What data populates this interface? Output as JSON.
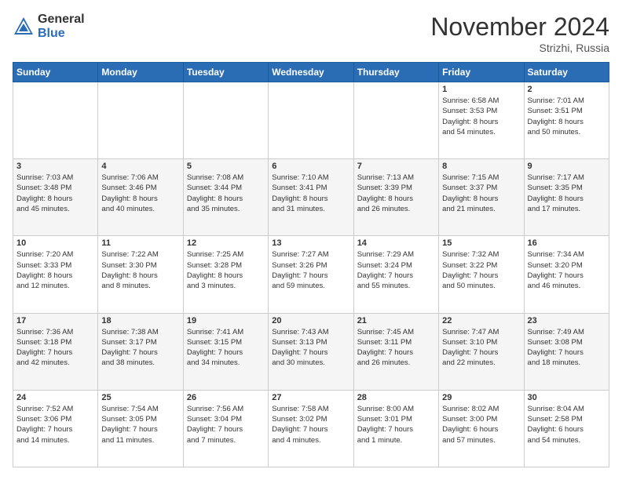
{
  "header": {
    "logo_general": "General",
    "logo_blue": "Blue",
    "title": "November 2024",
    "location": "Strizhi, Russia"
  },
  "weekdays": [
    "Sunday",
    "Monday",
    "Tuesday",
    "Wednesday",
    "Thursday",
    "Friday",
    "Saturday"
  ],
  "weeks": [
    [
      {
        "day": "",
        "info": ""
      },
      {
        "day": "",
        "info": ""
      },
      {
        "day": "",
        "info": ""
      },
      {
        "day": "",
        "info": ""
      },
      {
        "day": "",
        "info": ""
      },
      {
        "day": "1",
        "info": "Sunrise: 6:58 AM\nSunset: 3:53 PM\nDaylight: 8 hours\nand 54 minutes."
      },
      {
        "day": "2",
        "info": "Sunrise: 7:01 AM\nSunset: 3:51 PM\nDaylight: 8 hours\nand 50 minutes."
      }
    ],
    [
      {
        "day": "3",
        "info": "Sunrise: 7:03 AM\nSunset: 3:48 PM\nDaylight: 8 hours\nand 45 minutes."
      },
      {
        "day": "4",
        "info": "Sunrise: 7:06 AM\nSunset: 3:46 PM\nDaylight: 8 hours\nand 40 minutes."
      },
      {
        "day": "5",
        "info": "Sunrise: 7:08 AM\nSunset: 3:44 PM\nDaylight: 8 hours\nand 35 minutes."
      },
      {
        "day": "6",
        "info": "Sunrise: 7:10 AM\nSunset: 3:41 PM\nDaylight: 8 hours\nand 31 minutes."
      },
      {
        "day": "7",
        "info": "Sunrise: 7:13 AM\nSunset: 3:39 PM\nDaylight: 8 hours\nand 26 minutes."
      },
      {
        "day": "8",
        "info": "Sunrise: 7:15 AM\nSunset: 3:37 PM\nDaylight: 8 hours\nand 21 minutes."
      },
      {
        "day": "9",
        "info": "Sunrise: 7:17 AM\nSunset: 3:35 PM\nDaylight: 8 hours\nand 17 minutes."
      }
    ],
    [
      {
        "day": "10",
        "info": "Sunrise: 7:20 AM\nSunset: 3:33 PM\nDaylight: 8 hours\nand 12 minutes."
      },
      {
        "day": "11",
        "info": "Sunrise: 7:22 AM\nSunset: 3:30 PM\nDaylight: 8 hours\nand 8 minutes."
      },
      {
        "day": "12",
        "info": "Sunrise: 7:25 AM\nSunset: 3:28 PM\nDaylight: 8 hours\nand 3 minutes."
      },
      {
        "day": "13",
        "info": "Sunrise: 7:27 AM\nSunset: 3:26 PM\nDaylight: 7 hours\nand 59 minutes."
      },
      {
        "day": "14",
        "info": "Sunrise: 7:29 AM\nSunset: 3:24 PM\nDaylight: 7 hours\nand 55 minutes."
      },
      {
        "day": "15",
        "info": "Sunrise: 7:32 AM\nSunset: 3:22 PM\nDaylight: 7 hours\nand 50 minutes."
      },
      {
        "day": "16",
        "info": "Sunrise: 7:34 AM\nSunset: 3:20 PM\nDaylight: 7 hours\nand 46 minutes."
      }
    ],
    [
      {
        "day": "17",
        "info": "Sunrise: 7:36 AM\nSunset: 3:18 PM\nDaylight: 7 hours\nand 42 minutes."
      },
      {
        "day": "18",
        "info": "Sunrise: 7:38 AM\nSunset: 3:17 PM\nDaylight: 7 hours\nand 38 minutes."
      },
      {
        "day": "19",
        "info": "Sunrise: 7:41 AM\nSunset: 3:15 PM\nDaylight: 7 hours\nand 34 minutes."
      },
      {
        "day": "20",
        "info": "Sunrise: 7:43 AM\nSunset: 3:13 PM\nDaylight: 7 hours\nand 30 minutes."
      },
      {
        "day": "21",
        "info": "Sunrise: 7:45 AM\nSunset: 3:11 PM\nDaylight: 7 hours\nand 26 minutes."
      },
      {
        "day": "22",
        "info": "Sunrise: 7:47 AM\nSunset: 3:10 PM\nDaylight: 7 hours\nand 22 minutes."
      },
      {
        "day": "23",
        "info": "Sunrise: 7:49 AM\nSunset: 3:08 PM\nDaylight: 7 hours\nand 18 minutes."
      }
    ],
    [
      {
        "day": "24",
        "info": "Sunrise: 7:52 AM\nSunset: 3:06 PM\nDaylight: 7 hours\nand 14 minutes."
      },
      {
        "day": "25",
        "info": "Sunrise: 7:54 AM\nSunset: 3:05 PM\nDaylight: 7 hours\nand 11 minutes."
      },
      {
        "day": "26",
        "info": "Sunrise: 7:56 AM\nSunset: 3:04 PM\nDaylight: 7 hours\nand 7 minutes."
      },
      {
        "day": "27",
        "info": "Sunrise: 7:58 AM\nSunset: 3:02 PM\nDaylight: 7 hours\nand 4 minutes."
      },
      {
        "day": "28",
        "info": "Sunrise: 8:00 AM\nSunset: 3:01 PM\nDaylight: 7 hours\nand 1 minute."
      },
      {
        "day": "29",
        "info": "Sunrise: 8:02 AM\nSunset: 3:00 PM\nDaylight: 6 hours\nand 57 minutes."
      },
      {
        "day": "30",
        "info": "Sunrise: 8:04 AM\nSunset: 2:58 PM\nDaylight: 6 hours\nand 54 minutes."
      }
    ]
  ]
}
